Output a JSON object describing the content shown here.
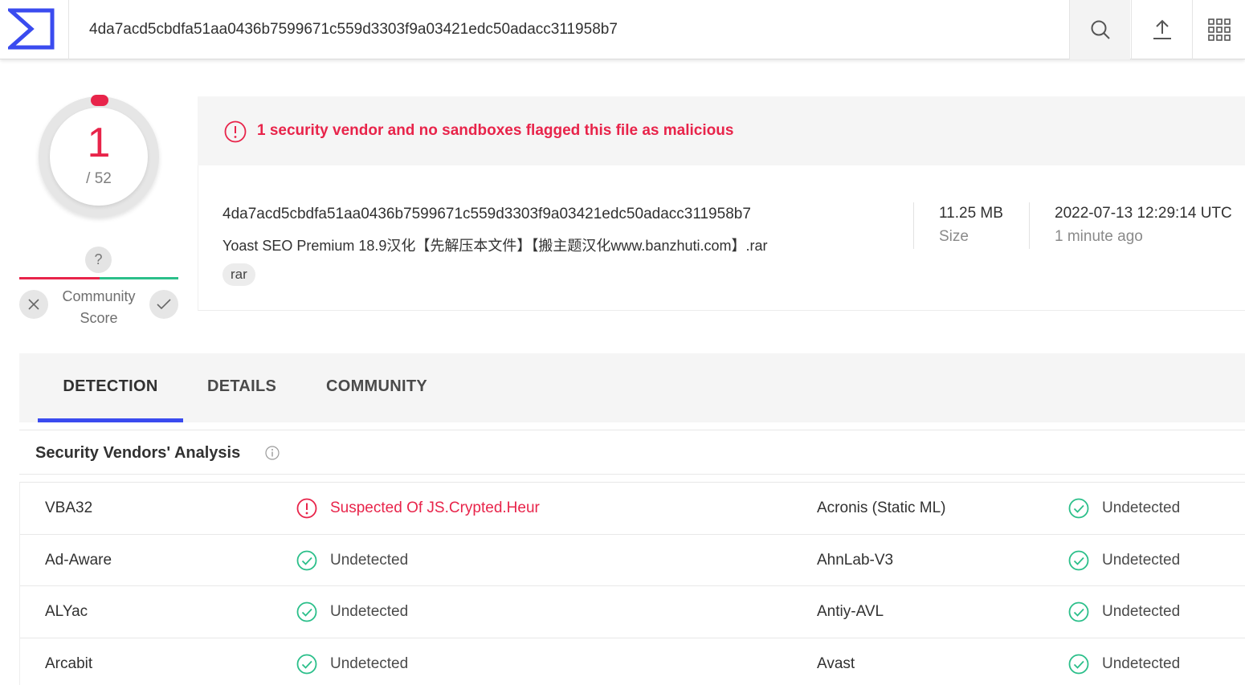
{
  "topbar": {
    "search_value": "4da7acd5cbdfa51aa0436b7599671c559d3303f9a03421edc50adacc311958b7",
    "icons": [
      "virustotal-logo",
      "search-icon",
      "upload-icon",
      "apps-grid-icon"
    ]
  },
  "score": {
    "detections": "1",
    "total": "/ 52",
    "malicious_ratio": 0.0192
  },
  "community": {
    "question": "?",
    "label_line1": "Community",
    "label_line2": "Score"
  },
  "alert": {
    "text": "1 security vendor and no sandboxes flagged this file as malicious"
  },
  "file": {
    "hash": "4da7acd5cbdfa51aa0436b7599671c559d3303f9a03421edc50adacc311958b7",
    "name": "Yoast SEO Premium 18.9汉化【先解压本文件】【搬主题汉化www.banzhuti.com】.rar",
    "tag": "rar",
    "size_value": "11.25 MB",
    "size_label": "Size",
    "date_value": "2022-07-13 12:29:14 UTC",
    "date_label": "1 minute ago"
  },
  "tabs": {
    "detection": "DETECTION",
    "details": "DETAILS",
    "community": "COMMUNITY"
  },
  "section": {
    "title": "Security Vendors' Analysis"
  },
  "vendors": [
    {
      "left_name": "VBA32",
      "left_result": "Suspected Of JS.Crypted.Heur",
      "right_name": "Acronis (Static ML)",
      "right_result": "Undetected"
    },
    {
      "left_name": "Ad-Aware",
      "left_result": "Undetected",
      "right_name": "AhnLab-V3",
      "right_result": "Undetected"
    },
    {
      "left_name": "ALYac",
      "left_result": "Undetected",
      "right_name": "Antiy-AVL",
      "right_result": "Undetected"
    },
    {
      "left_name": "Arcabit",
      "left_result": "Undetected",
      "right_name": "Avast",
      "right_result": "Undetected"
    }
  ],
  "colors": {
    "malicious": "#e8244a",
    "clean": "#2bbf8a",
    "accent": "#3a4bef"
  }
}
